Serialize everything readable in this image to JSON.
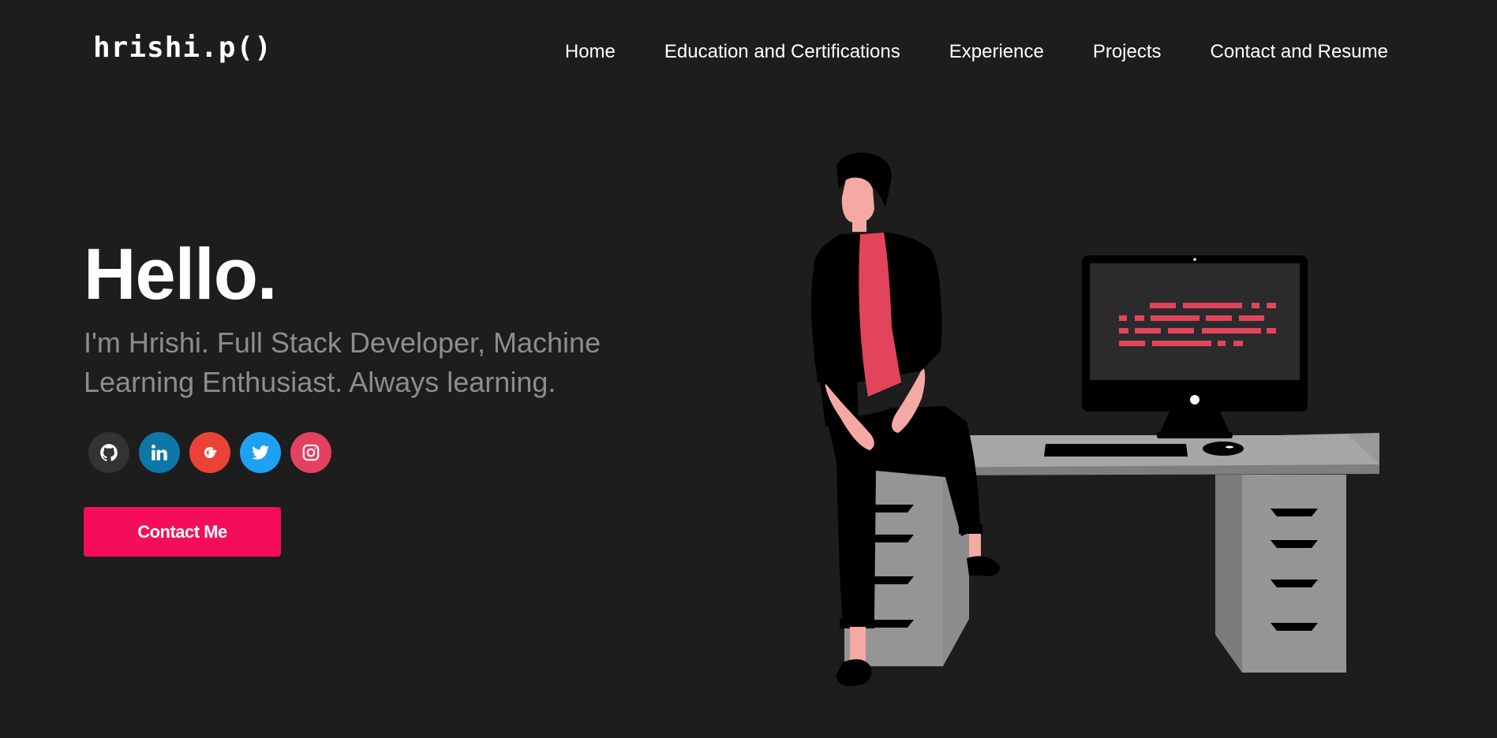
{
  "header": {
    "logo": "hrishi.p()",
    "nav": [
      {
        "label": "Home"
      },
      {
        "label": "Education and Certifications"
      },
      {
        "label": "Experience"
      },
      {
        "label": "Projects"
      },
      {
        "label": "Contact and Resume"
      }
    ]
  },
  "hero": {
    "greeting": "Hello.",
    "tagline": "I'm Hrishi. Full Stack Developer, Machine Learning Enthusiast. Always learning.",
    "contact_button": "Contact Me"
  },
  "socials": [
    {
      "icon": "github-icon",
      "color": "#333333"
    },
    {
      "icon": "linkedin-icon",
      "color": "#0e76a8"
    },
    {
      "icon": "google-icon",
      "color": "#ea4335"
    },
    {
      "icon": "twitter-icon",
      "color": "#1da1f2"
    },
    {
      "icon": "instagram-icon",
      "color": "#e4405f"
    }
  ],
  "colors": {
    "background": "#1d1d1d",
    "accent": "#f50d5a",
    "tagline": "#8d8d8d",
    "illustration_accent": "#e2445c"
  }
}
